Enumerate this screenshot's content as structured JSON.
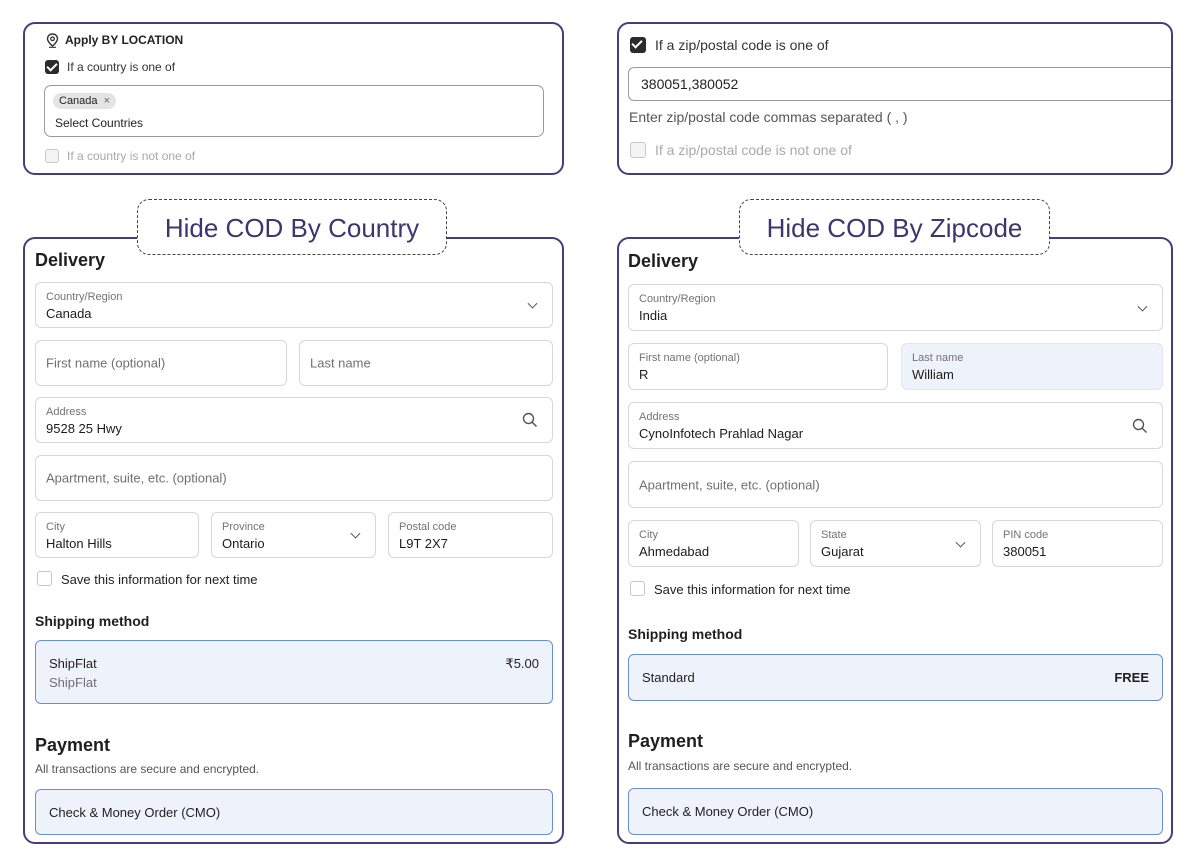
{
  "country_rule": {
    "header": "Apply BY LOCATION",
    "include_label": "If a country is one of",
    "chip": "Canada",
    "chip_close": "×",
    "select_placeholder": "Select Countries",
    "exclude_label": "If a country is not one of"
  },
  "zip_rule": {
    "include_label": "If a zip/postal code is one of",
    "input_value": "380051,380052",
    "help_text": "Enter zip/postal code commas separated ( , )",
    "exclude_label": "If a zip/postal code is not one of"
  },
  "tag_country": "Hide COD By Country",
  "tag_zip": "Hide COD By Zipcode",
  "country_form": {
    "delivery_title": "Delivery",
    "country_label": "Country/Region",
    "country_value": "Canada",
    "first_name_placeholder": "First name (optional)",
    "last_name_placeholder": "Last name",
    "address_label": "Address",
    "address_value": "9528 25 Hwy",
    "apartment_placeholder": "Apartment, suite, etc. (optional)",
    "city_label": "City",
    "city_value": "Halton Hills",
    "province_label": "Province",
    "province_value": "Ontario",
    "postal_label": "Postal code",
    "postal_value": "L9T 2X7",
    "save_info": "Save this information for next time",
    "shipping_title": "Shipping method",
    "shipping_name": "ShipFlat",
    "shipping_sub": "ShipFlat",
    "shipping_price": "₹5.00",
    "payment_title": "Payment",
    "payment_sub": "All transactions are secure and encrypted.",
    "payment_option": "Check & Money Order (CMO)"
  },
  "zip_form": {
    "delivery_title": "Delivery",
    "country_label": "Country/Region",
    "country_value": "India",
    "first_name_label": "First name (optional)",
    "first_name_value": "R",
    "last_name_label": "Last name",
    "last_name_value": "William",
    "address_label": "Address",
    "address_value": "CynoInfotech Prahlad Nagar",
    "apartment_placeholder": "Apartment, suite, etc. (optional)",
    "city_label": "City",
    "city_value": "Ahmedabad",
    "state_label": "State",
    "state_value": "Gujarat",
    "pin_label": "PIN code",
    "pin_value": "380051",
    "save_info": "Save this information for next time",
    "shipping_title": "Shipping method",
    "shipping_name": "Standard",
    "shipping_price": "FREE",
    "payment_title": "Payment",
    "payment_sub": "All transactions are secure and encrypted.",
    "payment_option": "Check & Money Order (CMO)"
  },
  "colors": {
    "panel_border": "#4a3a80",
    "selected_border": "#6a8fcf",
    "selected_fill": "#eef2fa"
  }
}
